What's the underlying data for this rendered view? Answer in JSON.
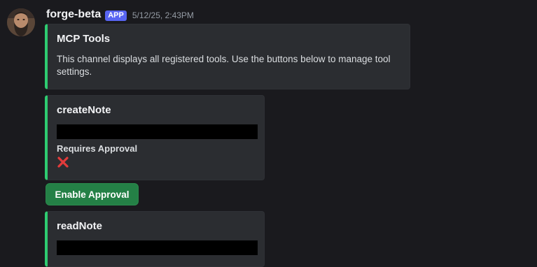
{
  "message": {
    "author": "forge-beta",
    "badge": "APP",
    "timestamp": "5/12/25, 2:43PM",
    "avatar_icon": "bearded-man-avatar"
  },
  "embeds": [
    {
      "title": "MCP Tools",
      "description": "This channel displays all registered tools. Use the buttons below to manage tool settings.",
      "accent_color": "#2ecc71"
    },
    {
      "title": "createNote",
      "field_name": "Requires Approval",
      "field_value_icon": "red-x-icon",
      "accent_color": "#2ecc71"
    },
    {
      "title": "readNote",
      "accent_color": "#2ecc71"
    }
  ],
  "buttons": {
    "enable_approval_label": "Enable Approval",
    "color": "#248046"
  },
  "colors": {
    "background": "#1a1a1e",
    "embed_background": "#2b2d31",
    "badge": "#5865f2",
    "timestamp": "#949ba4"
  }
}
